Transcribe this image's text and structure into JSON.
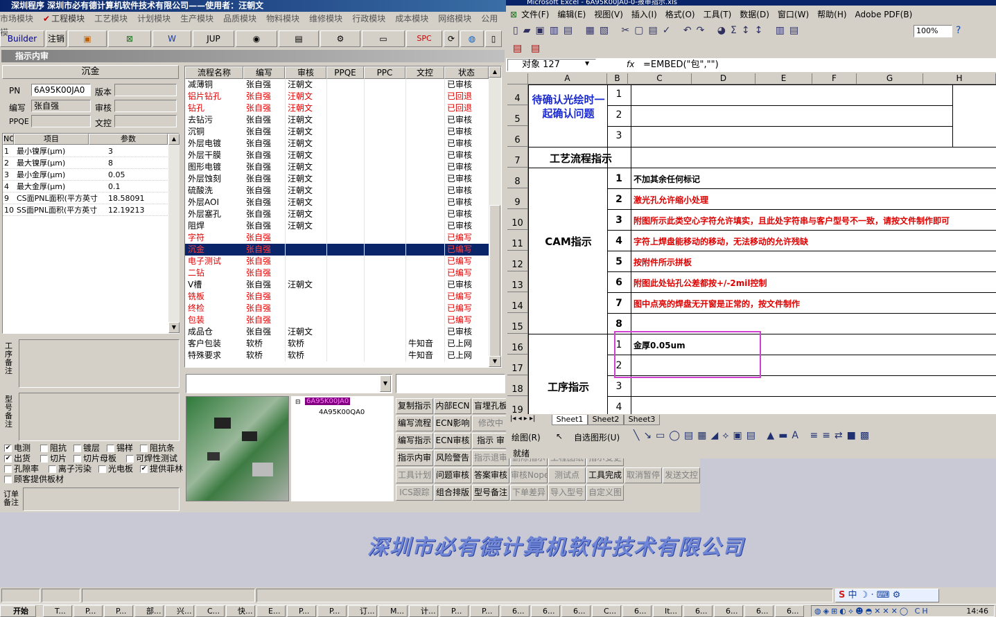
{
  "left_app": {
    "title": "深圳程序    深圳市必有德计算机软件技术有限公司——使用者：汪朝文",
    "menu": [
      "市场模块",
      "工程模块",
      "工艺模块",
      "计划模块",
      "生产模块",
      "品质模块",
      "物料模块",
      "维修模块",
      "行政模块",
      "成本模块",
      "网络模块",
      "公用模"
    ],
    "toolbar": {
      "builder": "Builder",
      "logout": "注销",
      "jup": "JUP",
      "spc": "SPC"
    },
    "subtitle": "指示内审",
    "process_name": "沉金",
    "fields": {
      "pn_label": "PN",
      "pn": "6A95K00JA0",
      "version_label": "版本",
      "version": "",
      "writer_label": "编写",
      "writer": "张自强",
      "review_label": "审核",
      "review": "",
      "ppqe_label": "PPQE",
      "ppqe": "",
      "doc_label": "文控",
      "doc": ""
    },
    "params_headers": [
      "NO",
      "项目",
      "参数"
    ],
    "params": [
      {
        "no": "1",
        "item": "最小镍厚(μm)",
        "value": "3"
      },
      {
        "no": "2",
        "item": "最大镍厚(μm)",
        "value": "8"
      },
      {
        "no": "3",
        "item": "最小金厚(μm)",
        "value": "0.05"
      },
      {
        "no": "4",
        "item": "最大金厚(μm)",
        "value": "0.1"
      },
      {
        "no": "9",
        "item": "CS面PNL面积(平方英寸",
        "value": "18.58091"
      },
      {
        "no": "10",
        "item": "SS面PNL面积(平方英寸",
        "value": "12.19213"
      }
    ],
    "note_labels": {
      "process": "工序备注",
      "model": "型号备注",
      "order": "订单备注"
    },
    "checkboxes": [
      {
        "label": "电测",
        "checked": true
      },
      {
        "label": "阻抗",
        "checked": false
      },
      {
        "label": "镀层",
        "checked": false
      },
      {
        "label": "锡样",
        "checked": false
      },
      {
        "label": "阻抗条",
        "checked": false
      },
      {
        "label": "出货",
        "checked": true
      },
      {
        "label": "切片",
        "checked": false
      },
      {
        "label": "切片母板",
        "checked": false
      },
      {
        "label": "可焊性测试",
        "checked": false
      },
      {
        "label": "孔隙率",
        "checked": false
      },
      {
        "label": "离子污染",
        "checked": false
      },
      {
        "label": "光电板",
        "checked": false
      },
      {
        "label": "提供菲林",
        "checked": true
      },
      {
        "label": "顾客提供板材",
        "checked": false
      }
    ],
    "flow_headers": [
      "流程名称",
      "编写",
      "审核",
      "PPQE",
      "PPC",
      "文控",
      "状态"
    ],
    "flows": [
      {
        "name": "减薄铜",
        "writer": "张自强",
        "review": "汪朝文",
        "ppqe": "",
        "ppc": "",
        "doc": "",
        "status": "已审核",
        "red": false
      },
      {
        "name": "铝片钻孔",
        "writer": "张自强",
        "review": "汪朝文",
        "ppqe": "",
        "ppc": "",
        "doc": "",
        "status": "已回退",
        "red": true
      },
      {
        "name": "钻孔",
        "writer": "张自强",
        "review": "汪朝文",
        "ppqe": "",
        "ppc": "",
        "doc": "",
        "status": "已回退",
        "red": true
      },
      {
        "name": "去钻污",
        "writer": "张自强",
        "review": "汪朝文",
        "ppqe": "",
        "ppc": "",
        "doc": "",
        "status": "已审核",
        "red": false
      },
      {
        "name": "沉铜",
        "writer": "张自强",
        "review": "汪朝文",
        "ppqe": "",
        "ppc": "",
        "doc": "",
        "status": "已审核",
        "red": false
      },
      {
        "name": "外层电镀",
        "writer": "张自强",
        "review": "汪朝文",
        "ppqe": "",
        "ppc": "",
        "doc": "",
        "status": "已审核",
        "red": false
      },
      {
        "name": "外层干膜",
        "writer": "张自强",
        "review": "汪朝文",
        "ppqe": "",
        "ppc": "",
        "doc": "",
        "status": "已审核",
        "red": false
      },
      {
        "name": "图形电镀",
        "writer": "张自强",
        "review": "汪朝文",
        "ppqe": "",
        "ppc": "",
        "doc": "",
        "status": "已审核",
        "red": false
      },
      {
        "name": "外层蚀刻",
        "writer": "张自强",
        "review": "汪朝文",
        "ppqe": "",
        "ppc": "",
        "doc": "",
        "status": "已审核",
        "red": false
      },
      {
        "name": "硫酸洗",
        "writer": "张自强",
        "review": "汪朝文",
        "ppqe": "",
        "ppc": "",
        "doc": "",
        "status": "已审核",
        "red": false
      },
      {
        "name": "外层AOI",
        "writer": "张自强",
        "review": "汪朝文",
        "ppqe": "",
        "ppc": "",
        "doc": "",
        "status": "已审核",
        "red": false
      },
      {
        "name": "外层塞孔",
        "writer": "张自强",
        "review": "汪朝文",
        "ppqe": "",
        "ppc": "",
        "doc": "",
        "status": "已审核",
        "red": false
      },
      {
        "name": "阻焊",
        "writer": "张自强",
        "review": "汪朝文",
        "ppqe": "",
        "ppc": "",
        "doc": "",
        "status": "已审核",
        "red": false
      },
      {
        "name": "字符",
        "writer": "张自强",
        "review": "",
        "ppqe": "",
        "ppc": "",
        "doc": "",
        "status": "已编写",
        "red": true
      },
      {
        "name": "沉金",
        "writer": "张自强",
        "review": "",
        "ppqe": "",
        "ppc": "",
        "doc": "",
        "status": "已编写",
        "red": true,
        "selected": true
      },
      {
        "name": "电子测试",
        "writer": "张自强",
        "review": "",
        "ppqe": "",
        "ppc": "",
        "doc": "",
        "status": "已编写",
        "red": true
      },
      {
        "name": "二钻",
        "writer": "张自强",
        "review": "",
        "ppqe": "",
        "ppc": "",
        "doc": "",
        "status": "已编写",
        "red": true
      },
      {
        "name": "V槽",
        "writer": "张自强",
        "review": "汪朝文",
        "ppqe": "",
        "ppc": "",
        "doc": "",
        "status": "已审核",
        "red": false
      },
      {
        "name": "铣板",
        "writer": "张自强",
        "review": "",
        "ppqe": "",
        "ppc": "",
        "doc": "",
        "status": "已编写",
        "red": true
      },
      {
        "name": "终检",
        "writer": "张自强",
        "review": "",
        "ppqe": "",
        "ppc": "",
        "doc": "",
        "status": "已编写",
        "red": true
      },
      {
        "name": "包装",
        "writer": "张自强",
        "review": "",
        "ppqe": "",
        "ppc": "",
        "doc": "",
        "status": "已编写",
        "red": true
      },
      {
        "name": "成品仓",
        "writer": "张自强",
        "review": "汪朝文",
        "ppqe": "",
        "ppc": "",
        "doc": "",
        "status": "已审核",
        "red": false
      },
      {
        "name": "客户包装",
        "writer": "软桥",
        "review": "软桥",
        "ppqe": "",
        "ppc": "",
        "doc": "牛知音",
        "status": "已上网",
        "red": false
      },
      {
        "name": "特殊要求",
        "writer": "软桥",
        "review": "软桥",
        "ppqe": "",
        "ppc": "",
        "doc": "牛知音",
        "status": "已上网",
        "red": false
      }
    ],
    "tree": {
      "root": "6A95K00JA0",
      "child": "4A95K00QA0"
    },
    "action_buttons": [
      [
        "复制指示",
        "内部ECN",
        "盲埋孔板"
      ],
      [
        "编写流程",
        "ECN影响",
        "修改中"
      ],
      [
        "编写指示",
        "ECN审核",
        "指示 审"
      ],
      [
        "指示内审",
        "风险警告",
        "指示退审",
        "删除指示",
        "工程图纸",
        "指示变更"
      ],
      [
        "工具计划",
        "问题审核",
        "答案审核",
        "审核Nope",
        "测试点",
        "工具完成",
        "取消暂停",
        "发送文控"
      ],
      [
        "ICS跟踪",
        "组合排版",
        "型号备注",
        "下单差异",
        "导入型号",
        "自定义图"
      ]
    ],
    "company": "深圳市必有德计算机软件技术有限公司"
  },
  "excel": {
    "title": "Microsoft Excel - 6A95K00JA0-0-报审指示.xls",
    "menu": [
      "文件(F)",
      "编辑(E)",
      "视图(V)",
      "插入(I)",
      "格式(O)",
      "工具(T)",
      "数据(D)",
      "窗口(W)",
      "帮助(H)",
      "Adobe PDF(B)"
    ],
    "zoom": "100%",
    "name_box": "对象 127",
    "fx": "fx",
    "formula": "=EMBED(\"包\",\"\")",
    "columns": [
      "A",
      "B",
      "C",
      "D",
      "E",
      "F",
      "G",
      "H"
    ],
    "row_numbers": [
      "4",
      "5",
      "6",
      "7",
      "8",
      "9",
      "10",
      "11",
      "12",
      "13",
      "14",
      "15",
      "16",
      "17",
      "18",
      "19"
    ],
    "label_confirm": "待确认光绘时一起确认问题",
    "label_flow": "工艺流程指示",
    "label_cam": "CAM指示",
    "label_process": "工序指示",
    "confirm_nums": [
      "1",
      "2",
      "3"
    ],
    "cam_rows": [
      {
        "n": "1",
        "text": "不加其余任何标记",
        "red": false
      },
      {
        "n": "2",
        "text": "激光孔允许缩小处理",
        "red": true
      },
      {
        "n": "3",
        "text": "附图所示此类空心字符允许填实，且此处字符串与客户型号不一致，请按文件制作即可",
        "red": true
      },
      {
        "n": "4",
        "text": "字符上焊盘能移动的移动，无法移动的允许残缺",
        "red": true
      },
      {
        "n": "5",
        "text": "按附件所示拼板",
        "red": true
      },
      {
        "n": "6",
        "text": "附图此处钻孔公差都按+/-2mil控制",
        "red": true
      },
      {
        "n": "7",
        "text": "图中点亮的焊盘无开窗是正常的，按文件制作",
        "red": true
      },
      {
        "n": "8",
        "text": "",
        "red": false
      }
    ],
    "proc_rows": [
      {
        "n": "1",
        "text": "金厚0.05um"
      },
      {
        "n": "2",
        "text": ""
      },
      {
        "n": "3",
        "text": ""
      },
      {
        "n": "4",
        "text": ""
      }
    ],
    "sheets": [
      "Sheet1",
      "Sheet2",
      "Sheet3"
    ],
    "draw_label": "绘图(R)",
    "autoshape": "自选图形(U)",
    "status": "就绪"
  },
  "taskbar": {
    "start": "开始",
    "clock": "14:46",
    "items": [
      "T...",
      "P...",
      "P...",
      "部...",
      "兴...",
      "C...",
      "快...",
      "E...",
      "P...",
      "P...",
      "订...",
      "M...",
      "计...",
      "P...",
      "P...",
      "6...",
      "6...",
      "6...",
      "C...",
      "6...",
      "It...",
      "6...",
      "6...",
      "6...",
      "6..."
    ]
  },
  "tray": {
    "ime": "中"
  }
}
